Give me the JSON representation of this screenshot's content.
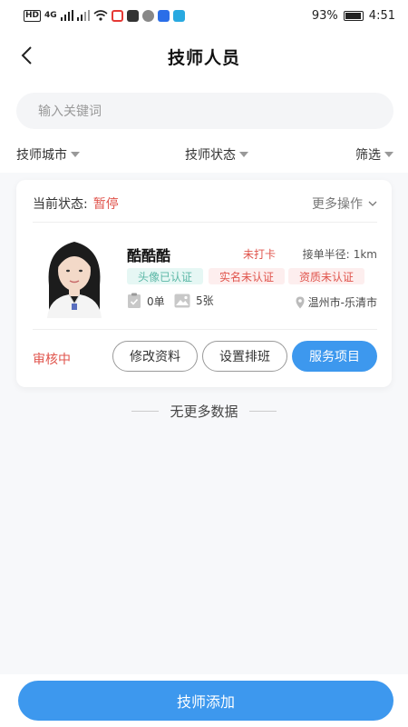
{
  "status_bar": {
    "left_tags": [
      "HD",
      "4G"
    ],
    "battery_percent": "93%",
    "battery_level": 0.93,
    "time": "4:51"
  },
  "nav": {
    "back_icon": "chevron-left-icon",
    "title": "技师人员"
  },
  "search": {
    "placeholder": "输入关键词"
  },
  "filters": {
    "city": "技师城市",
    "status": "技师状态",
    "screen": "筛选"
  },
  "card": {
    "status_label": "当前状态:",
    "status_value": "暂停",
    "more_ops": "更多操作",
    "name": "酷酷酷",
    "punch_status": "未打卡",
    "radius_label": "接单半径:",
    "radius_value": "1km",
    "badges": [
      "头像已认证",
      "实名未认证",
      "资质未认证"
    ],
    "orders": "0单",
    "photos": "5张",
    "location": "温州市-乐清市",
    "review_status": "审核中",
    "buttons": {
      "edit": "修改资料",
      "schedule": "设置排班",
      "service": "服务项目"
    }
  },
  "list_end": "无更多数据",
  "bottom": {
    "add_button": "技师添加"
  },
  "colors": {
    "primary": "#3d98ee",
    "danger": "#e0544c",
    "success": "#5bb7a6"
  }
}
